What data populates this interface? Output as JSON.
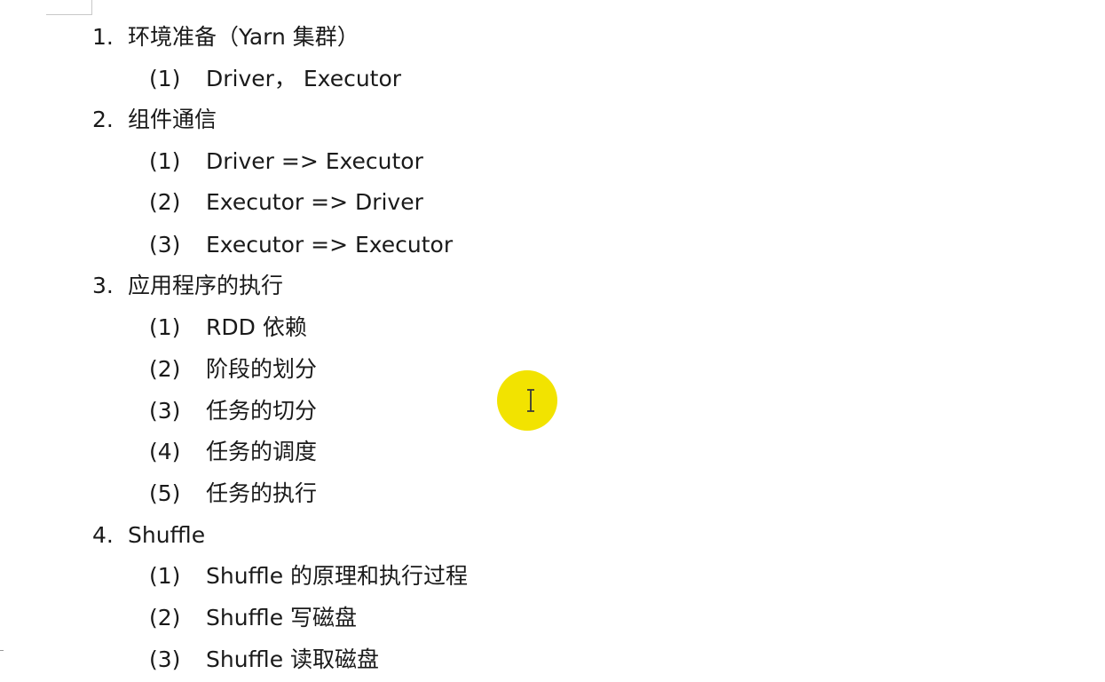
{
  "document": {
    "sections": [
      {
        "number": "1.",
        "title": "环境准备（Yarn 集群）",
        "items": [
          {
            "number": "(1)",
            "text": "Driver， Executor"
          }
        ]
      },
      {
        "number": "2.",
        "title": "组件通信",
        "items": [
          {
            "number": "(1)",
            "text": "Driver => Executor"
          },
          {
            "number": "(2)",
            "text": "Executor => Driver"
          },
          {
            "number": "(3)",
            "text": "Executor => Executor"
          }
        ]
      },
      {
        "number": "3.",
        "title": "应用程序的执行",
        "items": [
          {
            "number": "(1)",
            "text": "RDD 依赖"
          },
          {
            "number": "(2)",
            "text": "阶段的划分"
          },
          {
            "number": "(3)",
            "text": "任务的切分"
          },
          {
            "number": "(4)",
            "text": "任务的调度"
          },
          {
            "number": "(5)",
            "text": "任务的执行"
          }
        ]
      },
      {
        "number": "4.",
        "title": "Shuffle",
        "items": [
          {
            "number": "(1)",
            "text": "Shuffle 的原理和执行过程"
          },
          {
            "number": "(2)",
            "text": "Shuffle 写磁盘"
          },
          {
            "number": "(3)",
            "text": "Shuffle 读取磁盘"
          }
        ]
      }
    ]
  },
  "cursor": {
    "icon": "text-ibeam-icon",
    "highlight_color": "#f2e300"
  }
}
